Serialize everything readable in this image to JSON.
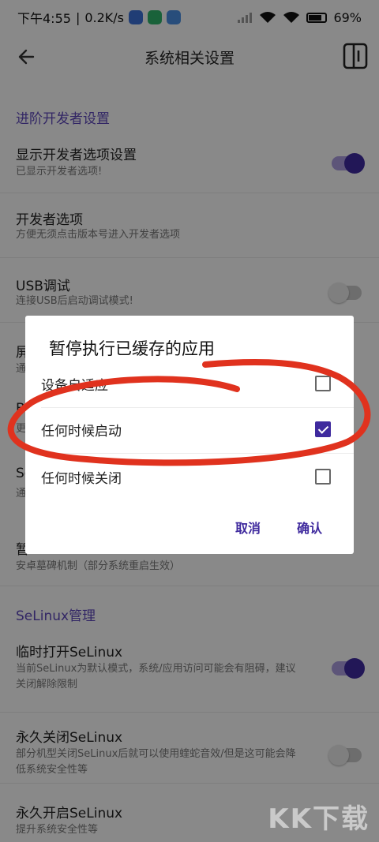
{
  "status": {
    "time": "下午4:55",
    "speed": "0.2K/s",
    "battery": "69%"
  },
  "appbar": {
    "title": "系统相关设置"
  },
  "sections": {
    "dev_header": "进阶开发者设置",
    "selinux_header": "SeLinux管理"
  },
  "items": {
    "show_dev": {
      "title": "显示开发者选项设置",
      "subtitle": "已显示开发者选项!"
    },
    "dev_opts": {
      "title": "开发者选项",
      "subtitle": "方便无须点击版本号进入开发者选项"
    },
    "usb": {
      "title": "USB调试",
      "subtitle": "连接USB后启动调试模式!"
    },
    "hidden1": {
      "title": "屏",
      "subtitle": "通"
    },
    "hidden2": {
      "title": "B",
      "subtitle": "更"
    },
    "hidden3": {
      "title": "Se",
      "subtitle": "通"
    },
    "hidden4": {
      "title": "暂",
      "subtitle": "安卓墓碑机制（部分系统重启生效）"
    },
    "selinux_temp": {
      "title": "临时打开SeLinux",
      "subtitle": "当前SeLinux为默认模式，系统/应用访问可能会有阻碍，建议关闭解除限制"
    },
    "selinux_off": {
      "title": "永久关闭SeLinux",
      "subtitle": "部分机型关闭SeLinux后就可以使用蝰蛇音效/但是这可能会降低系统安全性等"
    },
    "selinux_on": {
      "title": "永久开启SeLinux",
      "subtitle": "提升系统安全性等"
    }
  },
  "toggles": {
    "show_dev": true,
    "usb": false,
    "selinux_temp": true,
    "selinux_off": false
  },
  "dialog": {
    "title": "暂停执行已缓存的应用",
    "options": [
      {
        "label": "设备自适应",
        "checked": false
      },
      {
        "label": "任何时候启动",
        "checked": true
      },
      {
        "label": "任何时候关闭",
        "checked": false
      }
    ],
    "cancel_label": "取消",
    "confirm_label": "确认"
  },
  "watermark": "KK下载",
  "colors": {
    "accent": "#3f2a9e",
    "annotation": "#e0321e"
  }
}
